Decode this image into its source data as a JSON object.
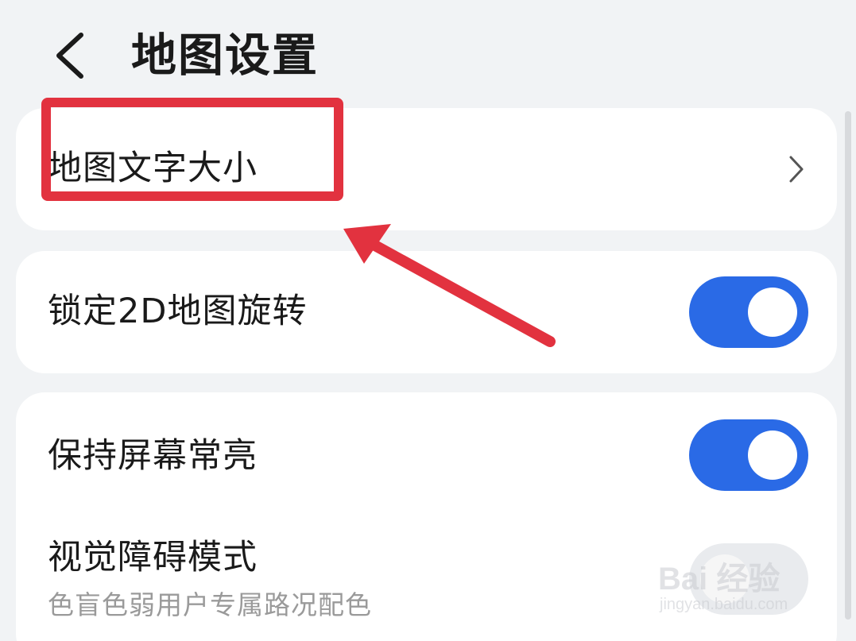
{
  "header": {
    "title": "地图设置",
    "back_icon": "back-arrow-icon"
  },
  "settings": {
    "map_text_size": {
      "label": "地图文字大小",
      "icon": "chevron-right-icon"
    },
    "lock_2d_rotation": {
      "label": "锁定2D地图旋转",
      "enabled": true
    },
    "keep_screen_on": {
      "label": "保持屏幕常亮",
      "enabled": true
    },
    "visual_impairment_mode": {
      "label": "视觉障碍模式",
      "description": "色盲色弱用户专属路况配色",
      "enabled": false
    }
  },
  "annotation": {
    "color": "#e2323f"
  },
  "watermark": {
    "brand": "Bai 经验",
    "url": "jingyan.baidu.com"
  },
  "colors": {
    "toggle_on": "#2a6ae6",
    "background": "#f1f3f5",
    "card": "#ffffff"
  }
}
